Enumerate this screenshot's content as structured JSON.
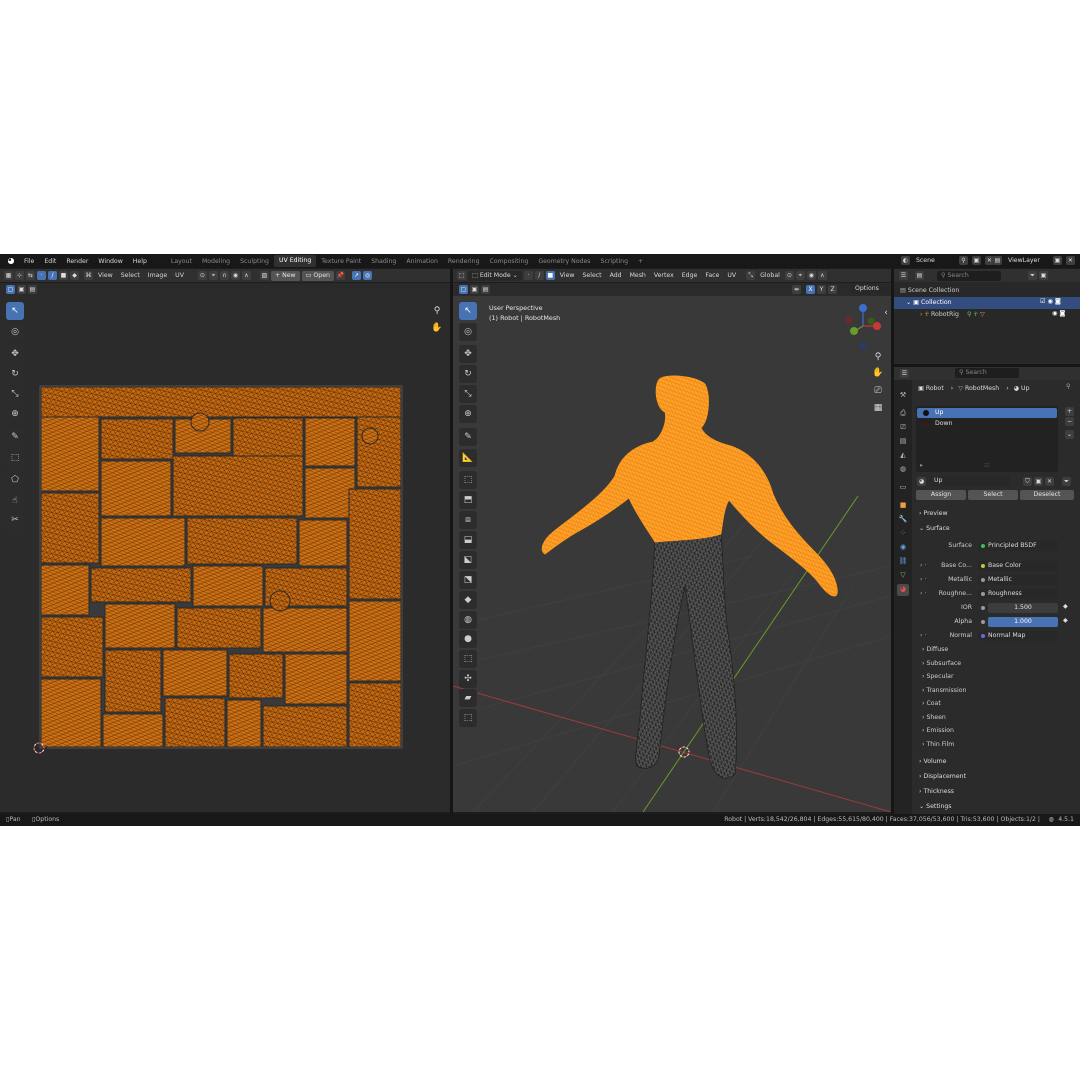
{
  "topbar": {
    "menus": [
      "File",
      "Edit",
      "Render",
      "Window",
      "Help"
    ],
    "workspaces": [
      "Layout",
      "Modeling",
      "Sculpting",
      "UV Editing",
      "Texture Paint",
      "Shading",
      "Animation",
      "Rendering",
      "Compositing",
      "Geometry Nodes",
      "Scripting"
    ],
    "active_workspace": "UV Editing",
    "add_tab": "+",
    "scene_label": "Scene",
    "viewlayer_label": "ViewLayer"
  },
  "uv_editor": {
    "menus": [
      "View",
      "Select",
      "Image",
      "UV"
    ],
    "new_label": "New",
    "open_label": "Open"
  },
  "viewport": {
    "mode_label": "Edit Mode",
    "menus": [
      "View",
      "Select",
      "Add",
      "Mesh",
      "Vertex",
      "Edge",
      "Face",
      "UV"
    ],
    "orientation": "Global",
    "axes": [
      "X",
      "Y",
      "Z"
    ],
    "options_label": "Options",
    "overlay_line1": "User Perspective",
    "overlay_line2": "(1) Robot | RobotMesh",
    "colors": {
      "selected": "#ff9a1a",
      "wire_dark": "#3a3a3a",
      "x_axis": "#a03a3a",
      "y_axis": "#6a9a2a"
    }
  },
  "outliner": {
    "search_placeholder": "Search",
    "scene_collection": "Scene Collection",
    "collection": "Collection",
    "item": "RobotRig"
  },
  "properties": {
    "search_placeholder": "Search",
    "breadcrumb": [
      "Robot",
      "RobotMesh",
      "Up"
    ],
    "material_slots": [
      "Up",
      "Down"
    ],
    "material_name": "Up",
    "assign_label": "Assign",
    "select_label": "Select",
    "deselect_label": "Deselect",
    "preview_label": "Preview",
    "surface_label": "Surface",
    "surface_row": {
      "label": "Surface",
      "value": "Principled BSDF"
    },
    "inputs": [
      {
        "label": "Base Co...",
        "value": "Base Color"
      },
      {
        "label": "Metallic",
        "value": "Metallic"
      },
      {
        "label": "Roughne...",
        "value": "Roughness"
      }
    ],
    "ior": {
      "label": "IOR",
      "value": "1.500"
    },
    "alpha": {
      "label": "Alpha",
      "value": "1.000"
    },
    "normal": {
      "label": "Normal",
      "value": "Normal Map"
    },
    "subpanels": [
      "Diffuse",
      "Subsurface",
      "Specular",
      "Transmission",
      "Coat",
      "Sheen",
      "Emission",
      "Thin Film"
    ],
    "panels": [
      "Volume",
      "Displacement",
      "Thickness",
      "Settings"
    ]
  },
  "statusbar": {
    "pan_label": "Pan",
    "options_label": "Options",
    "stats": "Robot | Verts:18,542/26,804 | Edges:55,615/80,400 | Faces:37,056/53,600 | Tris:53,600 | Objects:1/2 |",
    "version": "4.5.1"
  }
}
